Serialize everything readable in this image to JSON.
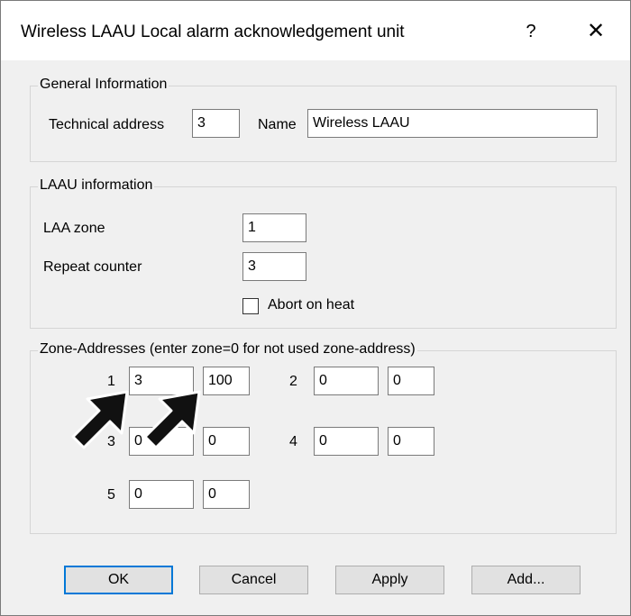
{
  "window": {
    "title": "Wireless LAAU Local alarm acknowledgement unit",
    "help_label": "?",
    "close_label": "✕"
  },
  "general": {
    "legend": "General Information",
    "tech_address_label": "Technical address",
    "tech_address_value": "3",
    "name_label": "Name",
    "name_value": "Wireless LAAU"
  },
  "laau": {
    "legend": "LAAU information",
    "zone_label": "LAA zone",
    "zone_value": "1",
    "repeat_label": "Repeat counter",
    "repeat_value": "3",
    "abort_label": "Abort on heat",
    "abort_checked": false
  },
  "zones": {
    "legend": "Zone-Addresses (enter zone=0 for not used zone-address)",
    "rows": [
      {
        "num": "1",
        "zone": "3",
        "address": "100"
      },
      {
        "num": "2",
        "zone": "0",
        "address": "0"
      },
      {
        "num": "3",
        "zone": "0",
        "address": "0"
      },
      {
        "num": "4",
        "zone": "0",
        "address": "0"
      },
      {
        "num": "5",
        "zone": "0",
        "address": "0"
      }
    ]
  },
  "buttons": {
    "ok": "OK",
    "cancel": "Cancel",
    "apply": "Apply",
    "add": "Add..."
  },
  "icons": {
    "annotation": "pointer-arrow-icon"
  }
}
